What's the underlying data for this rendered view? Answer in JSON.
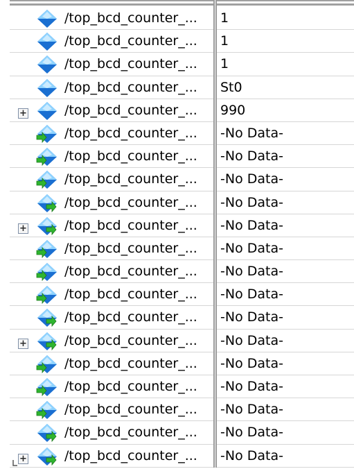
{
  "signals": [
    {
      "name": "/top_bcd_counter_...",
      "value": "1",
      "icon": "signal-diamond-icon",
      "expandable": false
    },
    {
      "name": "/top_bcd_counter_...",
      "value": "1",
      "icon": "signal-diamond-icon",
      "expandable": false
    },
    {
      "name": "/top_bcd_counter_...",
      "value": "1",
      "icon": "signal-diamond-icon",
      "expandable": false
    },
    {
      "name": "/top_bcd_counter_...",
      "value": "St0",
      "icon": "signal-diamond-icon",
      "expandable": false
    },
    {
      "name": "/top_bcd_counter_...",
      "value": "990",
      "icon": "signal-diamond-icon",
      "expandable": true
    },
    {
      "name": "/top_bcd_counter_...",
      "value": "-No Data-",
      "icon": "signal-input-icon",
      "expandable": false
    },
    {
      "name": "/top_bcd_counter_...",
      "value": "-No Data-",
      "icon": "signal-input-icon",
      "expandable": false
    },
    {
      "name": "/top_bcd_counter_...",
      "value": "-No Data-",
      "icon": "signal-input-icon",
      "expandable": false
    },
    {
      "name": "/top_bcd_counter_...",
      "value": "-No Data-",
      "icon": "signal-output-icon",
      "expandable": false
    },
    {
      "name": "/top_bcd_counter_...",
      "value": "-No Data-",
      "icon": "signal-output-icon",
      "expandable": true
    },
    {
      "name": "/top_bcd_counter_...",
      "value": "-No Data-",
      "icon": "signal-input-icon",
      "expandable": false
    },
    {
      "name": "/top_bcd_counter_...",
      "value": "-No Data-",
      "icon": "signal-input-icon",
      "expandable": false
    },
    {
      "name": "/top_bcd_counter_...",
      "value": "-No Data-",
      "icon": "signal-input-icon",
      "expandable": false
    },
    {
      "name": "/top_bcd_counter_...",
      "value": "-No Data-",
      "icon": "signal-output-icon",
      "expandable": false
    },
    {
      "name": "/top_bcd_counter_...",
      "value": "-No Data-",
      "icon": "signal-output-icon",
      "expandable": true
    },
    {
      "name": "/top_bcd_counter_...",
      "value": "-No Data-",
      "icon": "signal-input-icon",
      "expandable": false
    },
    {
      "name": "/top_bcd_counter_...",
      "value": "-No Data-",
      "icon": "signal-input-icon",
      "expandable": false
    },
    {
      "name": "/top_bcd_counter_...",
      "value": "-No Data-",
      "icon": "signal-input-icon",
      "expandable": false
    },
    {
      "name": "/top_bcd_counter_...",
      "value": "-No Data-",
      "icon": "signal-output-icon",
      "expandable": false
    },
    {
      "name": "/top_bcd_counter_...",
      "value": "-No Data-",
      "icon": "signal-output-icon",
      "expandable": true
    }
  ],
  "expander_symbol": "+",
  "colors": {
    "diamond_light": "#8fd3ff",
    "diamond_dark": "#1a6fd1",
    "arrow_green": "#2fb52f",
    "grid_line": "#d6d6d6"
  }
}
